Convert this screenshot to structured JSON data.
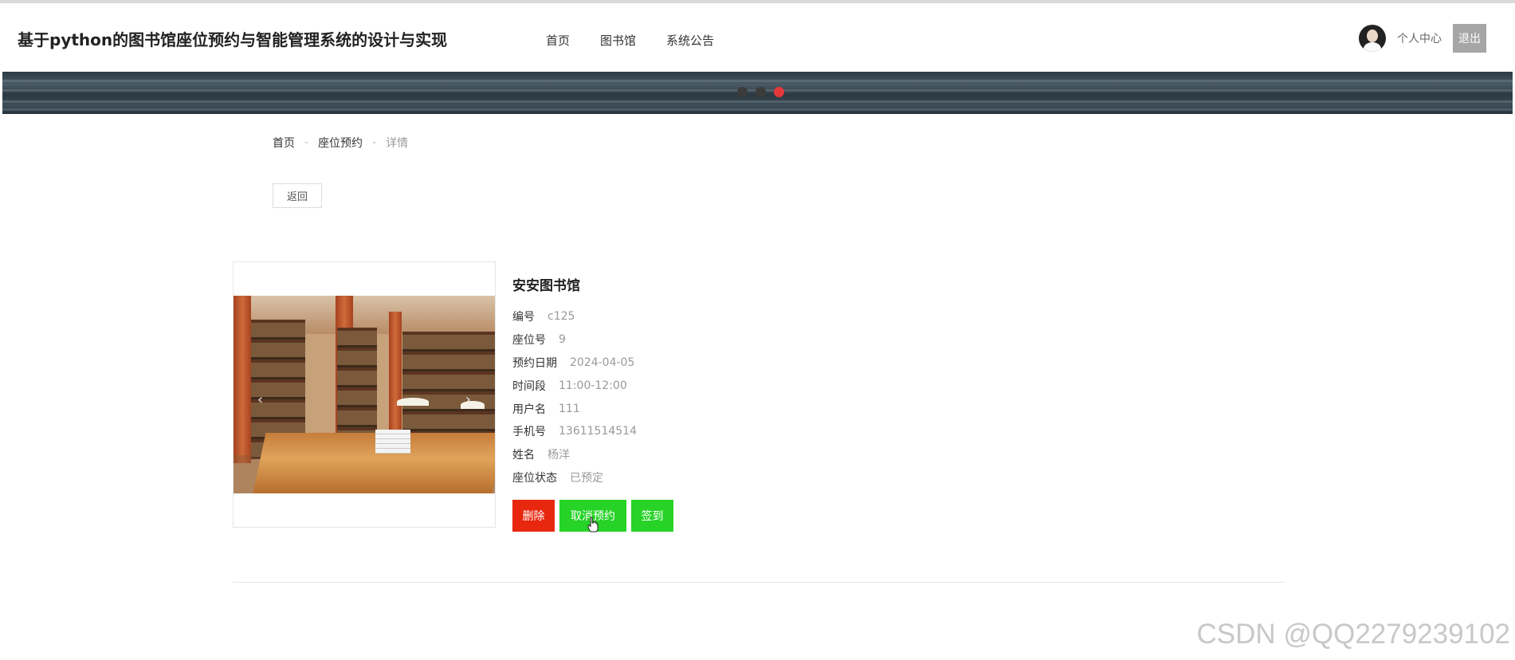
{
  "header": {
    "title": "基于python的图书馆座位预约与智能管理系统的设计与实现",
    "nav": [
      "首页",
      "图书馆",
      "系统公告"
    ],
    "user_center": "个人中心",
    "logout": "退出"
  },
  "banner": {
    "slide_count": 3,
    "active_index": 2
  },
  "breadcrumb": {
    "home": "首页",
    "section": "座位预约",
    "current": "详情"
  },
  "back_label": "返回",
  "detail": {
    "library_name": "安安图书馆",
    "fields": [
      {
        "label": "编号",
        "value": "c125"
      },
      {
        "label": "座位号",
        "value": "9"
      },
      {
        "label": "预约日期",
        "value": "2024-04-05"
      },
      {
        "label": "时间段",
        "value": "11:00-12:00"
      },
      {
        "label": "用户名",
        "value": "111"
      },
      {
        "label": "手机号",
        "value": "13611514514"
      },
      {
        "label": "姓名",
        "value": "杨洋"
      },
      {
        "label": "座位状态",
        "value": "已预定"
      }
    ]
  },
  "actions": {
    "delete": "删除",
    "cancel": "取消预约",
    "checkin": "签到"
  },
  "colors": {
    "delete": "#e8270f",
    "success": "#26d326",
    "active_dot": "#e5383b"
  },
  "watermark": "CSDN @QQ2279239102"
}
